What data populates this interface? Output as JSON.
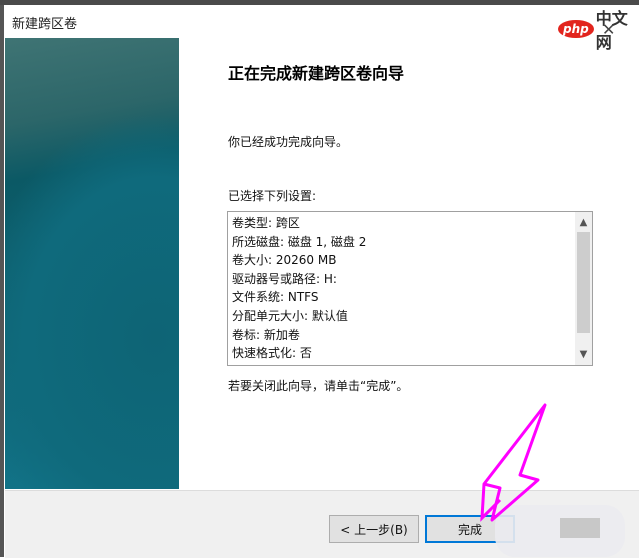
{
  "window": {
    "title": "新建跨区卷",
    "close_icon": "close-icon"
  },
  "watermark": {
    "logo": "php",
    "text": "中文网"
  },
  "content": {
    "heading": "正在完成新建跨区卷向导",
    "intro": "你已经成功完成向导。",
    "settings_label": "已选择下列设置:",
    "settings": [
      "卷类型: 跨区",
      "所选磁盘: 磁盘 1, 磁盘 2",
      "卷大小: 20260 MB",
      "驱动器号或路径: H:",
      "文件系统: NTFS",
      "分配单元大小: 默认值",
      "卷标: 新加卷",
      "快速格式化: 否"
    ],
    "closing": "若要关闭此向导，请单击“完成”。"
  },
  "buttons": {
    "back": "< 上一步(B)",
    "finish": "完成"
  },
  "colors": {
    "accent": "#0078d7",
    "annotation": "#ff00ff",
    "panel": "#0f6474"
  }
}
